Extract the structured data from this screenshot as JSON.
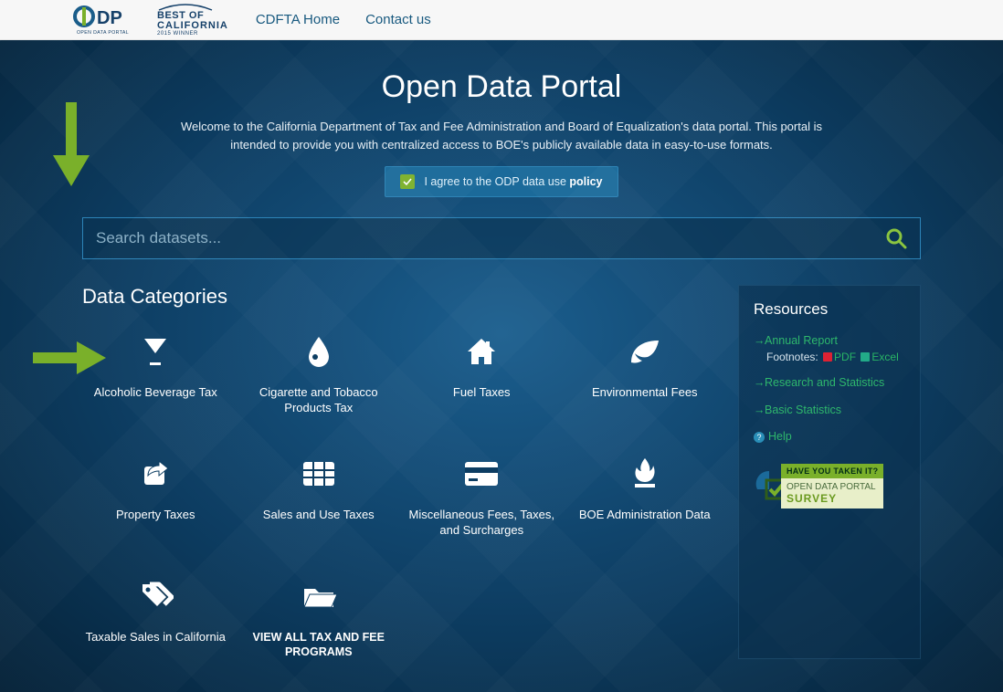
{
  "topbar": {
    "logo_subtitle": "OPEN DATA PORTAL",
    "best_of_line1": "BEST OF",
    "best_of_line2": "CALIFORNIA",
    "best_of_line3": "2015 WINNER",
    "nav": [
      {
        "label": "CDFTA Home"
      },
      {
        "label": "Contact us"
      }
    ]
  },
  "hero": {
    "title": "Open Data Portal",
    "subtitle": "Welcome to the California Department of Tax and Fee Administration and Board of Equalization's data portal. This portal is intended to provide you with centralized access to BOE's publicly available data in easy-to-use formats.",
    "agree_prefix": "I agree to the ODP data use ",
    "agree_link": "policy"
  },
  "search": {
    "placeholder": "Search datasets..."
  },
  "categories_title": "Data Categories",
  "categories": [
    {
      "label": "Alcoholic Beverage Tax",
      "icon": "glass"
    },
    {
      "label": "Cigarette and Tobacco Products Tax",
      "icon": "drop"
    },
    {
      "label": "Fuel Taxes",
      "icon": "home"
    },
    {
      "label": "Environmental Fees",
      "icon": "leaf"
    },
    {
      "label": "Property Taxes",
      "icon": "share"
    },
    {
      "label": "Sales and Use Taxes",
      "icon": "table"
    },
    {
      "label": "Miscellaneous Fees, Taxes, and Surcharges",
      "icon": "card"
    },
    {
      "label": "BOE Administration Data",
      "icon": "flame"
    },
    {
      "label": "Taxable Sales in California",
      "icon": "tags"
    },
    {
      "label": "VIEW ALL TAX AND FEE PROGRAMS",
      "icon": "folder",
      "viewall": true
    }
  ],
  "resources": {
    "title": "Resources",
    "items": {
      "annual": "Annual Report",
      "footnotes_label": "Footnotes:",
      "pdf": "PDF",
      "excel": "Excel",
      "research": "Research and Statistics",
      "basic": "Basic Statistics",
      "help": "Help"
    },
    "survey": {
      "badge": "HAVE YOU TAKEN IT?",
      "line1": "OPEN DATA PORTAL",
      "line2": "SURVEY"
    }
  }
}
